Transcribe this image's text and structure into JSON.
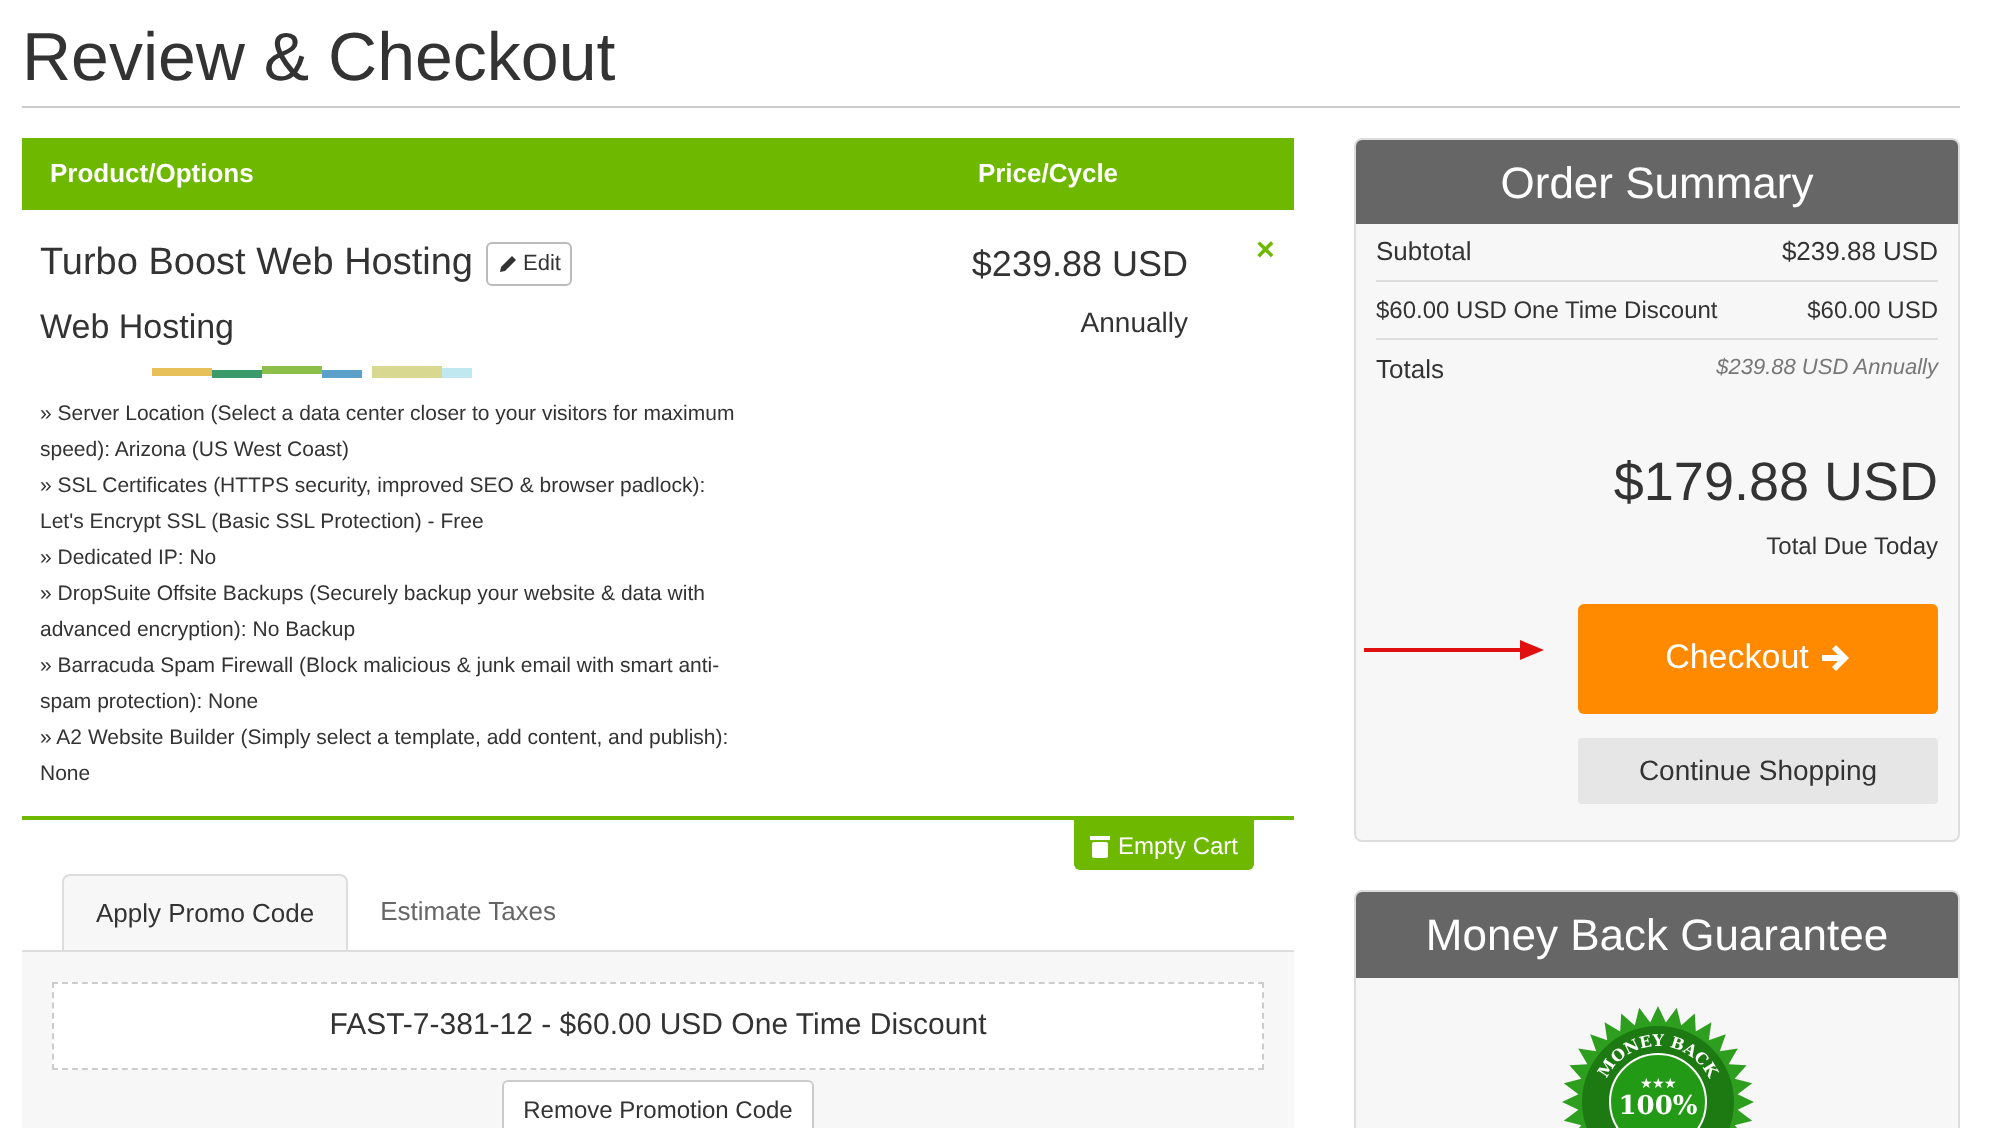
{
  "page_title": "Review & Checkout",
  "cart": {
    "columns": [
      "Product/Options",
      "Price/Cycle"
    ],
    "item": {
      "name": "Turbo Boost Web Hosting",
      "edit": "Edit",
      "group": "Web Hosting",
      "price": "$239.88 USD",
      "cycle": "Annually",
      "remove": "×",
      "options": [
        "» Server Location (Select a data center closer to your visitors for maximum speed): Arizona (US West Coast)",
        "» SSL Certificates (HTTPS security, improved SEO & browser padlock): Let's Encrypt SSL (Basic SSL Protection) - Free",
        "» Dedicated IP: No",
        "» DropSuite Offsite Backups (Securely backup your website & data with advanced encryption): No Backup",
        "» Barracuda Spam Firewall (Block malicious & junk email with smart anti-spam protection): None",
        "» A2 Website Builder (Simply select a template, add content, and publish): None"
      ]
    },
    "empty_cart": "Empty Cart"
  },
  "tabs": [
    {
      "label": "Apply Promo Code",
      "selected": true
    },
    {
      "label": "Estimate Taxes",
      "selected": false
    }
  ],
  "promo": {
    "applied": "FAST-7-381-12 - $60.00 USD One Time Discount",
    "remove": "Remove Promotion Code"
  },
  "order_summary": {
    "title": "Order Summary",
    "rows": [
      {
        "label": "Subtotal",
        "value": "$239.88 USD",
        "kind": "plain"
      },
      {
        "label": "$60.00 USD One Time Discount",
        "value": "$60.00 USD",
        "kind": "small"
      },
      {
        "label": "Totals",
        "value": "$239.88 USD Annually",
        "kind": "recurring"
      }
    ],
    "total": "$179.88 USD",
    "total_label": "Total Due Today",
    "checkout": "Checkout",
    "continue": "Continue Shopping"
  },
  "guarantee": {
    "title": "Money Back Guarantee",
    "seal_top": "MONEY BACK",
    "seal_stars": "★★★",
    "seal_main": "100%"
  }
}
